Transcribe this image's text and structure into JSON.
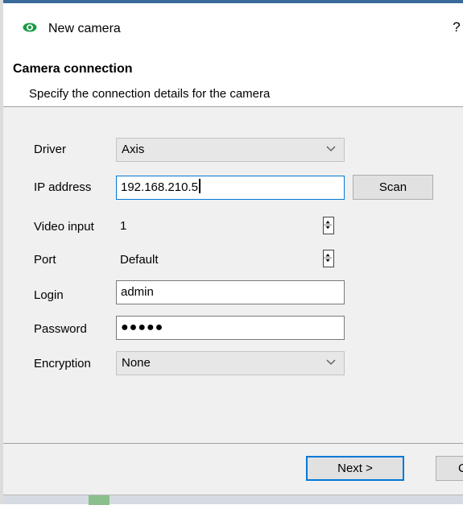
{
  "window": {
    "title": "New camera",
    "help_label": "?"
  },
  "header": {
    "title": "Camera connection",
    "subtitle": "Specify the connection details for the camera"
  },
  "form": {
    "driver": {
      "label": "Driver",
      "value": "Axis"
    },
    "ip_address": {
      "label": "IP address",
      "value": "192.168.210.5"
    },
    "video_input": {
      "label": "Video input",
      "value": "1"
    },
    "port": {
      "label": "Port",
      "value": "Default"
    },
    "login": {
      "label": "Login",
      "value": "admin"
    },
    "password": {
      "label": "Password",
      "value": "●●●●●"
    },
    "encryption": {
      "label": "Encryption",
      "value": "None"
    }
  },
  "buttons": {
    "scan": "Scan",
    "next": "Next >",
    "cancel": "C"
  },
  "colors": {
    "accent": "#0078d7",
    "icon_green": "#1a9b45",
    "content_bg": "#f0f0f0"
  },
  "icons": {
    "app": "eye-icon",
    "dropdown": "chevron-down-icon",
    "spinner": "spin-arrows-icon"
  }
}
